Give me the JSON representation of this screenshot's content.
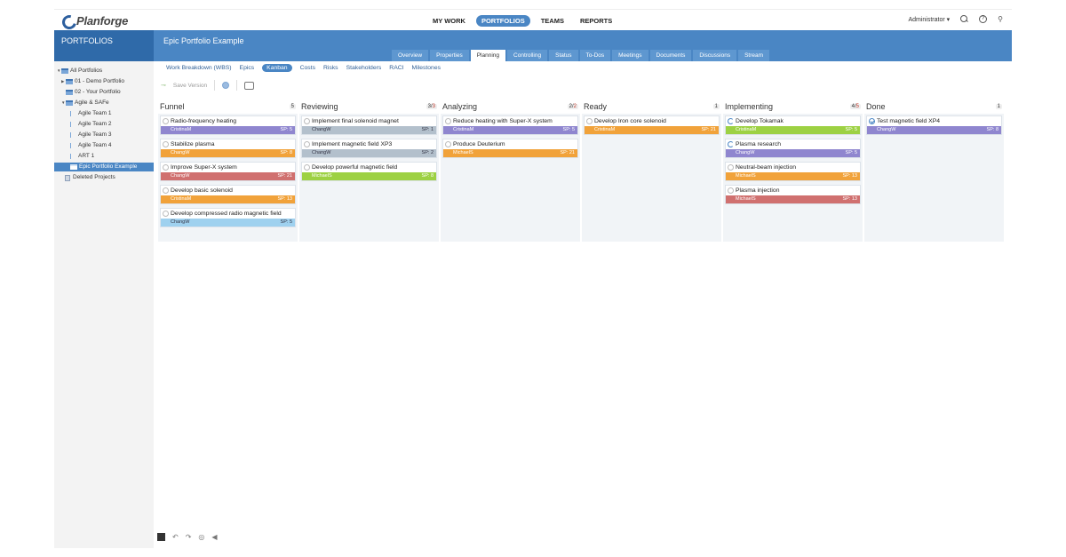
{
  "app": {
    "logo_text": "Planforge"
  },
  "topnav": [
    {
      "label": "MY WORK",
      "active": false
    },
    {
      "label": "PORTFOLIOS",
      "active": true
    },
    {
      "label": "TEAMS",
      "active": false
    },
    {
      "label": "REPORTS",
      "active": false
    }
  ],
  "user": {
    "name": "Administrator ▾"
  },
  "header": {
    "section_title": "PORTFOLIOS",
    "page_title": "Epic Portfolio Example"
  },
  "tabs": [
    {
      "label": "Overview",
      "active": false
    },
    {
      "label": "Properties",
      "active": false
    },
    {
      "label": "Planning",
      "active": true
    },
    {
      "label": "Controlling",
      "active": false
    },
    {
      "label": "Status",
      "active": false
    },
    {
      "label": "To-Dos",
      "active": false
    },
    {
      "label": "Meetings",
      "active": false
    },
    {
      "label": "Documents",
      "active": false
    },
    {
      "label": "Discussions",
      "active": false
    },
    {
      "label": "Stream",
      "active": false
    }
  ],
  "sidebar": {
    "items": [
      {
        "label": "All Portfolios",
        "icon": "portfolio-icon"
      },
      {
        "label": "01 - Demo Portfolio",
        "icon": "portfolio-icon"
      },
      {
        "label": "02 - Your Portfolio",
        "icon": "portfolio-icon"
      },
      {
        "label": "Agile & SAFe",
        "icon": "portfolio-icon"
      },
      {
        "label": "Agile Team 1",
        "icon": "team-icon"
      },
      {
        "label": "Agile Team 2",
        "icon": "team-icon"
      },
      {
        "label": "Agile Team 3",
        "icon": "team-icon"
      },
      {
        "label": "Agile Team 4",
        "icon": "team-icon"
      },
      {
        "label": "ART 1",
        "icon": "team-icon"
      },
      {
        "label": "Epic Portfolio Example",
        "icon": "project-icon"
      },
      {
        "label": "Deleted Projects",
        "icon": "trash-icon"
      }
    ]
  },
  "subnav": [
    {
      "label": "Work Breakdown (WBS)",
      "active": false
    },
    {
      "label": "Epics",
      "active": false
    },
    {
      "label": "Kanban",
      "active": true
    },
    {
      "label": "Costs",
      "active": false
    },
    {
      "label": "Risks",
      "active": false
    },
    {
      "label": "Stakeholders",
      "active": false
    },
    {
      "label": "RACI",
      "active": false
    },
    {
      "label": "Milestones",
      "active": false
    }
  ],
  "toolbar": {
    "save_version": "Save Version"
  },
  "colors": {
    "purple": "#8f86cf",
    "orange": "#f1a23a",
    "red": "#d0706f",
    "lightblue": "#9fd1ef",
    "grey": "#b3c0cc",
    "green": "#9dd143",
    "accent": "#4a86c4"
  },
  "board": {
    "columns": [
      {
        "title": "Funnel",
        "count": "5",
        "count_limit": "",
        "cards": [
          {
            "title": "Radio-frequency heating",
            "user": "CristinaM",
            "sp": "SP: 5",
            "color": "purple",
            "state": "open"
          },
          {
            "title": "Stabilize plasma",
            "user": "ChangW",
            "sp": "SP: 8",
            "color": "orange",
            "state": "open"
          },
          {
            "title": "Improve Super-X system",
            "user": "ChangW",
            "sp": "SP: 21",
            "color": "red",
            "state": "open"
          },
          {
            "title": "Develop basic solenoid",
            "user": "CristinaM",
            "sp": "SP: 13",
            "color": "orange",
            "state": "open"
          },
          {
            "title": "Develop compressed radio magnetic field",
            "user": "ChangW",
            "sp": "SP: 5",
            "color": "lightblue",
            "state": "open"
          }
        ]
      },
      {
        "title": "Reviewing",
        "count": "3",
        "count_limit": "3",
        "cards": [
          {
            "title": "Implement final solenoid magnet",
            "user": "ChangW",
            "sp": "SP: 1",
            "color": "grey",
            "state": "open"
          },
          {
            "title": "Implement magnetic field XP3",
            "user": "ChangW",
            "sp": "SP: 2",
            "color": "grey",
            "state": "open"
          },
          {
            "title": "Develop powerful magnetic field",
            "user": "MichaelS",
            "sp": "SP: 8",
            "color": "green",
            "state": "open"
          }
        ]
      },
      {
        "title": "Analyzing",
        "count": "2",
        "count_limit": "2",
        "cards": [
          {
            "title": "Reduce heating with Super-X system",
            "user": "CristinaM",
            "sp": "SP: 5",
            "color": "purple",
            "state": "open"
          },
          {
            "title": "Produce Deuterium",
            "user": "MichaelS",
            "sp": "SP: 21",
            "color": "orange",
            "state": "open"
          }
        ]
      },
      {
        "title": "Ready",
        "count": "1",
        "count_limit": "",
        "cards": [
          {
            "title": "Develop Iron core solenoid",
            "user": "CristinaM",
            "sp": "SP: 21",
            "color": "orange",
            "state": "progress"
          }
        ]
      },
      {
        "title": "Implementing",
        "count": "4",
        "count_limit": "5",
        "cards": [
          {
            "title": "Develop Tokamak",
            "user": "CristinaM",
            "sp": "SP: 5",
            "color": "green",
            "state": "spin"
          },
          {
            "title": "Plasma research",
            "user": "ChangW",
            "sp": "SP: 5",
            "color": "purple",
            "state": "spin"
          },
          {
            "title": "Neutral-beam injection",
            "user": "MichaelS",
            "sp": "SP: 13",
            "color": "orange",
            "state": "progress"
          },
          {
            "title": "Plasma injection",
            "user": "MichaelS",
            "sp": "SP: 13",
            "color": "red",
            "state": "progress"
          }
        ]
      },
      {
        "title": "Done",
        "count": "1",
        "count_limit": "",
        "cards": [
          {
            "title": "Test magnetic field XP4",
            "user": "ChangW",
            "sp": "SP: 8",
            "color": "purple",
            "state": "done"
          }
        ]
      }
    ]
  }
}
